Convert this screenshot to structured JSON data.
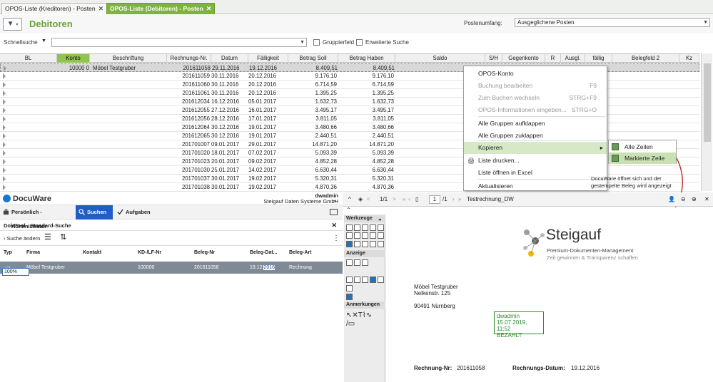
{
  "tabs": [
    {
      "label": "OPOS-Liste (Kreditoren) - Posten"
    },
    {
      "label": "OPOS-Liste (Debitoren) - Posten"
    }
  ],
  "header": {
    "title": "Debitoren",
    "postenumfang_label": "Postenumfang:",
    "postenumfang_value": "Ausgeglichene Posten",
    "schnellsuche_label": "Schnellsuche",
    "gruppierfeld": "Gruppierfeld",
    "erweiterte_suche": "Erweiterte Suche"
  },
  "grid": {
    "columns": [
      "BL",
      "Konto",
      "Beschriftung",
      "Rechnungs-Nr.",
      "Datum",
      "Fälligkeit",
      "Betrag Soll",
      "Betrag Haben",
      "Saldo",
      "S/H",
      "Gegenkonto",
      "R",
      "Ausgl.",
      "fällig",
      "Belegfeld 2",
      "Kz"
    ],
    "rows": [
      [
        "10000 0",
        "Möbel Testgruber",
        "201611058",
        "29.11.2016",
        "19.12.2016",
        "8.409,51",
        "8.409,51",
        "0,00",
        "",
        "1409 0",
        "",
        "A"
      ],
      [
        "",
        "",
        "201611059",
        "30.11.2016",
        "20.12.2016",
        "9.176,10",
        "9.176,10",
        "",
        "",
        "",
        "",
        ""
      ],
      [
        "",
        "",
        "201611060",
        "30.11.2016",
        "20.12.2016",
        "6.714,59",
        "6.714,59",
        "",
        "",
        "",
        "",
        ""
      ],
      [
        "",
        "",
        "201611061",
        "30.11.2016",
        "20.12.2016",
        "1.395,25",
        "1.395,25",
        "",
        "",
        "",
        "",
        ""
      ],
      [
        "",
        "",
        "201612034",
        "16.12.2016",
        "05.01.2017",
        "1.632,73",
        "1.632,73",
        "",
        "",
        "",
        "",
        ""
      ],
      [
        "",
        "",
        "201612055",
        "27.12.2016",
        "16.01.2017",
        "3.495,17",
        "3.495,17",
        "",
        "",
        "",
        "",
        ""
      ],
      [
        "",
        "",
        "201612056",
        "28.12.2016",
        "17.01.2017",
        "3.811,05",
        "3.811,05",
        "",
        "",
        "",
        "",
        ""
      ],
      [
        "",
        "",
        "201612064",
        "30.12.2016",
        "19.01.2017",
        "3.480,66",
        "3.480,66",
        "",
        "",
        "",
        "",
        ""
      ],
      [
        "",
        "",
        "201612065",
        "30.12.2016",
        "19.01.2017",
        "2.440,51",
        "2.440,51",
        "",
        "",
        "",
        "",
        ""
      ],
      [
        "",
        "",
        "201701007",
        "09.01.2017",
        "29.01.2017",
        "14.871,20",
        "14.871,20",
        "",
        "",
        "",
        "",
        ""
      ],
      [
        "",
        "",
        "201701020",
        "18.01.2017",
        "07.02.2017",
        "5.093,39",
        "5.093,39",
        "",
        "",
        "",
        "",
        ""
      ],
      [
        "",
        "",
        "201701023",
        "20.01.2017",
        "09.02.2017",
        "4.852,28",
        "4.852,28",
        "",
        "",
        "",
        "",
        ""
      ],
      [
        "",
        "",
        "201701030",
        "25.01.2017",
        "14.02.2017",
        "6.630,44",
        "6.630,44",
        "",
        "",
        "",
        "",
        ""
      ],
      [
        "",
        "",
        "201701037",
        "30.01.2017",
        "19.02.2017",
        "5.320,31",
        "5.320,31",
        "",
        "",
        "",
        "",
        ""
      ],
      [
        "",
        "",
        "201701038",
        "30.01.2017",
        "19.02.2017",
        "4.870,36",
        "4.870,36",
        "",
        "",
        "",
        "",
        ""
      ]
    ]
  },
  "context_menu": {
    "items": [
      {
        "label": "OPOS-Konto",
        "shortcut": ""
      },
      {
        "label": "Buchung bearbeiten",
        "shortcut": "F9"
      },
      {
        "label": "Zum Buchen wechseln",
        "shortcut": "STRG+F9"
      },
      {
        "label": "OPOS-Informationen eingeben...",
        "shortcut": "STRG+O"
      },
      {
        "label": "Alle Gruppen aufklappen",
        "shortcut": ""
      },
      {
        "label": "Alle Gruppen zuklappen",
        "shortcut": ""
      },
      {
        "label": "Kopieren",
        "shortcut": ""
      },
      {
        "label": "Liste drucken...",
        "shortcut": ""
      },
      {
        "label": "Liste öffnen in Excel",
        "shortcut": ""
      },
      {
        "label": "Aktualisieren",
        "shortcut": ""
      }
    ],
    "submenu": [
      "Alle Zeilen",
      "Markierte Zeile"
    ],
    "note": "DocuWare öffnet sich und der gestempelte Beleg wird angezeigt"
  },
  "docuware": {
    "logo": "DocuWare",
    "user": "dwadmin",
    "company": "Steigauf Daten Systeme GmbH",
    "nav": [
      "Persönlich - Administrator",
      "Suchen",
      "Aufgaben"
    ],
    "subtitle": "DokPool - Standard-Suche",
    "back": "Suche ändern",
    "columns": [
      "Typ",
      "Firma",
      "Kontakt",
      "KD-/LF-Nr",
      "Beleg-Nr",
      "Beleg-Dat...",
      "Beleg-Art"
    ],
    "row": {
      "firma": "Möbel Testgruber",
      "kdnr": "100000",
      "belegnr": "201611058",
      "date_a": "19.12.",
      "date_b": "2016",
      "art": "Rechnung"
    }
  },
  "viewer": {
    "page": "1/1",
    "page_input": "1",
    "page_total": "/1",
    "docname": "Testrechnung_DW",
    "werkzeuge": "Werkzeuge",
    "anzeige": "Anzeige",
    "zoom": "100%",
    "anmerkungen": "Anmerkungen",
    "logo_text": "Steigauf",
    "logo_sub": "Premium-Dokumenten-Management",
    "logo_sub2": "Zeit gewinnen & Transparenz schaffen",
    "addr": [
      "Möbel Testgruber",
      "Nelkenstr. 125",
      "90491 Nürnberg"
    ],
    "stamp": [
      "dwadmin",
      "15.07.2019, 11:52",
      "BEZAHLT"
    ],
    "rnr_label": "Rechnung-Nr:",
    "rnr": "201611058",
    "rdat_label": "Rechnungs-Datum:",
    "rdat": "19.12.2016"
  },
  "colors": {
    "accent": "#7fb23f",
    "blue": "#1f5fc3"
  }
}
